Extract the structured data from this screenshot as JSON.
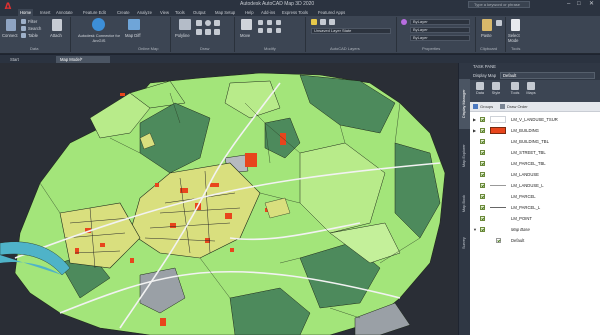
{
  "window": {
    "title": "Autodesk AutoCAD Map 3D 2020",
    "search_placeholder": "Type a keyword or phrase",
    "min": "–",
    "max": "□",
    "close": "✕"
  },
  "ribbon_tabs": [
    "Home",
    "Insert",
    "Annotate",
    "Feature Edit",
    "Create",
    "Analyze",
    "View",
    "Tools",
    "Output",
    "Map Setup",
    "Help",
    "Add-ins",
    "Express Tools",
    "Featured Apps"
  ],
  "ribbon": {
    "connect": "Connect",
    "filter": "Filter",
    "search": "Search",
    "table": "Table",
    "attach": "Attach",
    "connector": "Autodesk Connector for ArcGIS",
    "map_diff": "Map Diff",
    "polyline": "Polyline",
    "move": "Move",
    "layer_state": "Unsaved Layer State",
    "bylayer1": "ByLayer",
    "bylayer2": "ByLayer",
    "bylayer3": "ByLayer",
    "paste": "Paste",
    "select_mode": "Select Mode",
    "groups": {
      "data": "Data",
      "online_map": "Online Map",
      "draw": "Draw",
      "modify": "Modify",
      "layers": "AutoCAD Layers",
      "properties": "Properties",
      "clipboard": "Clipboard",
      "tools": "Tools"
    }
  },
  "doc_tabs": [
    "Start",
    "Map Model*"
  ],
  "task_pane": {
    "title": "TASK PANE",
    "display_manager_label": "Display Map",
    "map_name": "Default",
    "side_tabs": [
      "Display Manager",
      "Map Explorer",
      "Map Book",
      "Survey"
    ],
    "tools": [
      "Data",
      "Style",
      "Tools",
      "Maps"
    ],
    "groups_label": "Groups",
    "draw_order_label": "Draw Order",
    "layers": [
      {
        "name": "LM_V_LANDUSE_TSUR",
        "swatch": "none",
        "color": "#ffffff",
        "expander": "▶"
      },
      {
        "name": "LM_BUILDING",
        "swatch": "fill",
        "color": "#e8451c",
        "expander": "▶"
      },
      {
        "name": "LM_BUILDING_TBL",
        "swatch": "none",
        "color": "#ffffff",
        "expander": ""
      },
      {
        "name": "LM_STREET_TBL",
        "swatch": "none",
        "color": "#ffffff",
        "expander": ""
      },
      {
        "name": "LM_PARCEL_TBL",
        "swatch": "none",
        "color": "#ffffff",
        "expander": ""
      },
      {
        "name": "LM_LANDUSE",
        "swatch": "none",
        "color": "#ffffff",
        "expander": ""
      },
      {
        "name": "LM_LANDUSE_L",
        "swatch": "line",
        "color": "#999999",
        "expander": ""
      },
      {
        "name": "LM_PARCEL",
        "swatch": "none",
        "color": "#ffffff",
        "expander": ""
      },
      {
        "name": "LM_PARCEL_L",
        "swatch": "line",
        "color": "#666666",
        "expander": ""
      },
      {
        "name": "LM_POINT",
        "swatch": "none",
        "color": "#ffffff",
        "expander": ""
      },
      {
        "name": "Map Base",
        "swatch": "none",
        "color": "#ffffff",
        "expander": "▼",
        "italic": true
      },
      {
        "name": "Default",
        "swatch": "none",
        "color": "#ffffff",
        "expander": "",
        "child": true
      }
    ]
  },
  "colors": {
    "accent": "#3c4553",
    "parcel_green": "#a3e57a",
    "forest": "#4d8a5c",
    "building": "#e8451c",
    "water": "#4fb3c8"
  }
}
